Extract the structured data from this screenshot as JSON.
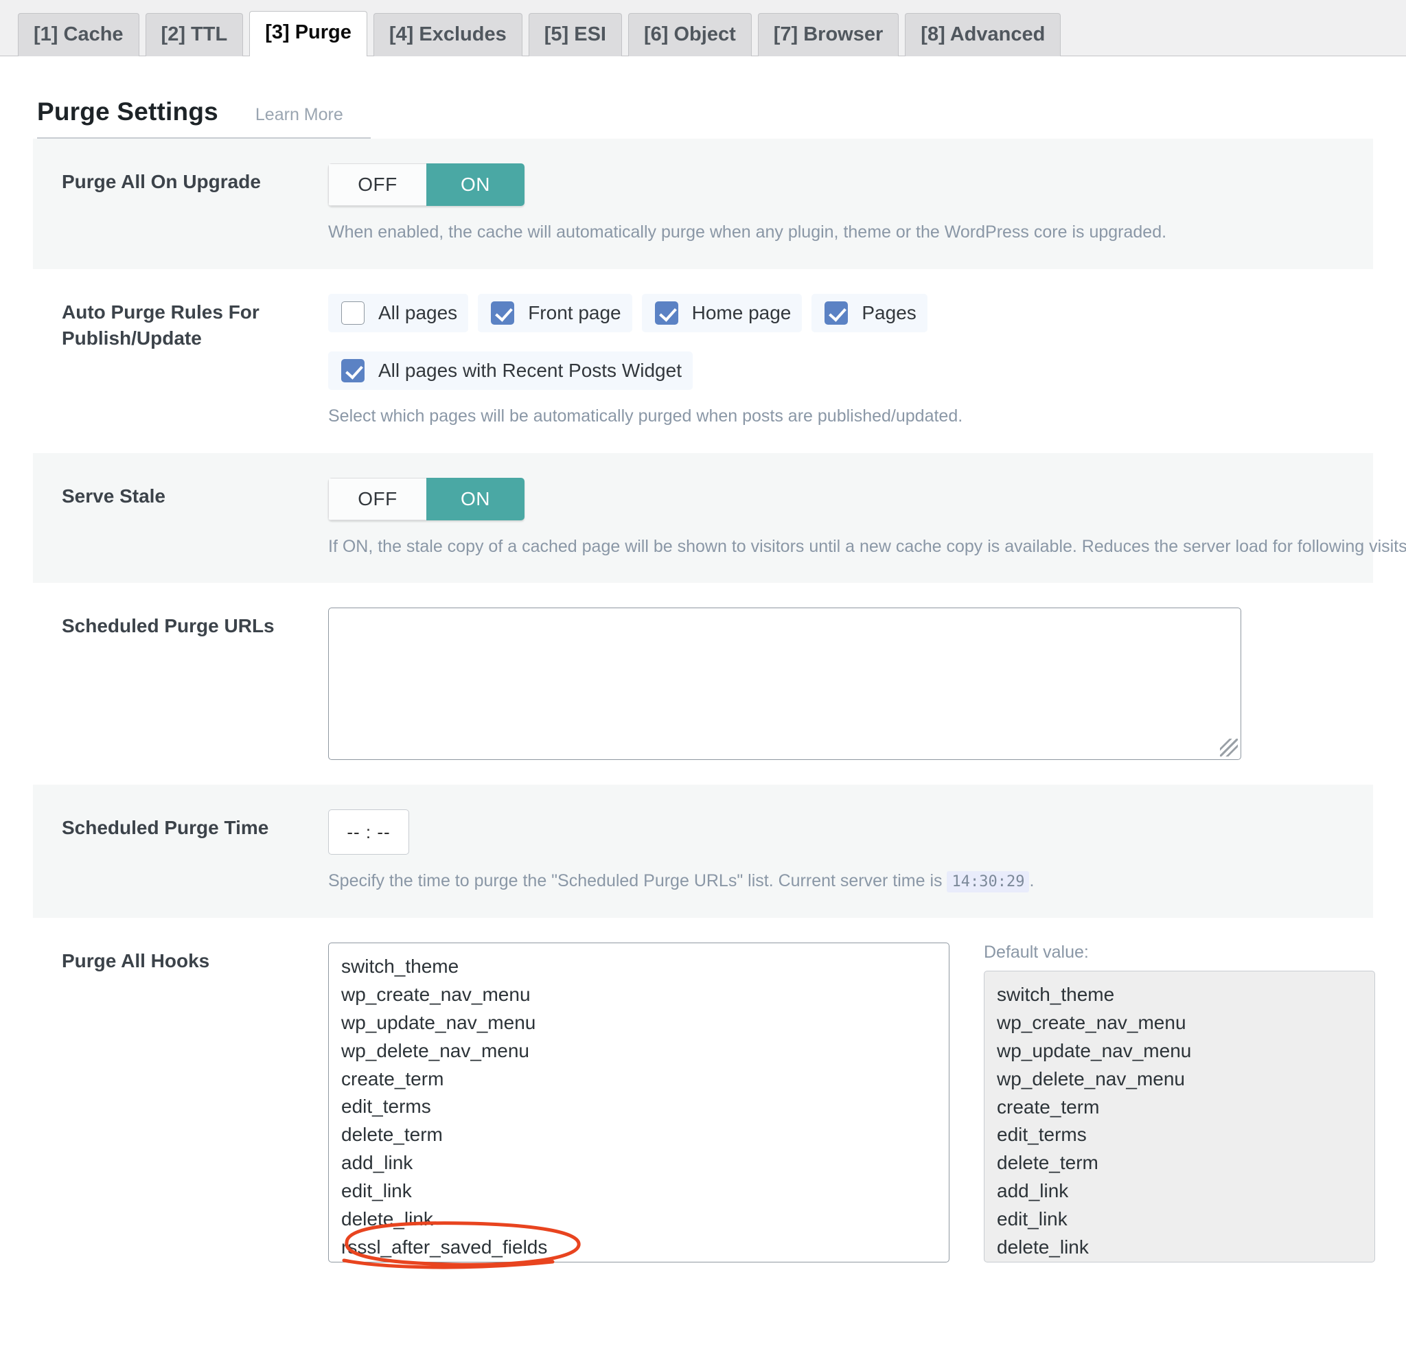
{
  "tabs": [
    {
      "label": "[1] Cache",
      "active": false
    },
    {
      "label": "[2] TTL",
      "active": false
    },
    {
      "label": "[3] Purge",
      "active": true
    },
    {
      "label": "[4] Excludes",
      "active": false
    },
    {
      "label": "[5] ESI",
      "active": false
    },
    {
      "label": "[6] Object",
      "active": false
    },
    {
      "label": "[7] Browser",
      "active": false
    },
    {
      "label": "[8] Advanced",
      "active": false
    }
  ],
  "header": {
    "title": "Purge Settings",
    "learn_more": "Learn More"
  },
  "colors": {
    "toggle_on": "#4aa8a4",
    "checkbox_checked": "#5b82c4",
    "annotation": "#e8441f"
  },
  "settings": {
    "purge_all_on_upgrade": {
      "label": "Purge All On Upgrade",
      "toggle_off": "OFF",
      "toggle_on": "ON",
      "value": "ON",
      "description": "When enabled, the cache will automatically purge when any plugin, theme or the WordPress core is upgraded."
    },
    "auto_purge_rules": {
      "label": "Auto Purge Rules For Publish/Update",
      "description": "Select which pages will be automatically purged when posts are published/updated.",
      "options_row1": [
        {
          "label": "All pages",
          "checked": false
        },
        {
          "label": "Front page",
          "checked": true
        },
        {
          "label": "Home page",
          "checked": true
        },
        {
          "label": "Pages",
          "checked": true
        }
      ],
      "options_row2": [
        {
          "label": "All pages with Recent Posts Widget",
          "checked": true
        }
      ]
    },
    "serve_stale": {
      "label": "Serve Stale",
      "toggle_off": "OFF",
      "toggle_on": "ON",
      "value": "ON",
      "description": "If ON, the stale copy of a cached page will be shown to visitors until a new cache copy is available. Reduces the server load for following visits."
    },
    "scheduled_purge_urls": {
      "label": "Scheduled Purge URLs",
      "value": "",
      "placeholder": ""
    },
    "scheduled_purge_time": {
      "label": "Scheduled Purge Time",
      "value": "-- : --",
      "description_before": "Specify the time to purge the \"Scheduled Purge URLs\" list. Current server time is",
      "server_time": "14:30:29",
      "description_after": "."
    },
    "purge_all_hooks": {
      "label": "Purge All Hooks",
      "default_value_label": "Default value:",
      "value_lines": [
        "switch_theme",
        "wp_create_nav_menu",
        "wp_update_nav_menu",
        "wp_delete_nav_menu",
        "create_term",
        "edit_terms",
        "delete_term",
        "add_link",
        "edit_link",
        "delete_link",
        "rsssl_after_saved_fields"
      ],
      "annotated_line": "rsssl_after_saved_fields",
      "default_lines": [
        "switch_theme",
        "wp_create_nav_menu",
        "wp_update_nav_menu",
        "wp_delete_nav_menu",
        "create_term",
        "edit_terms",
        "delete_term",
        "add_link",
        "edit_link",
        "delete_link"
      ]
    }
  }
}
